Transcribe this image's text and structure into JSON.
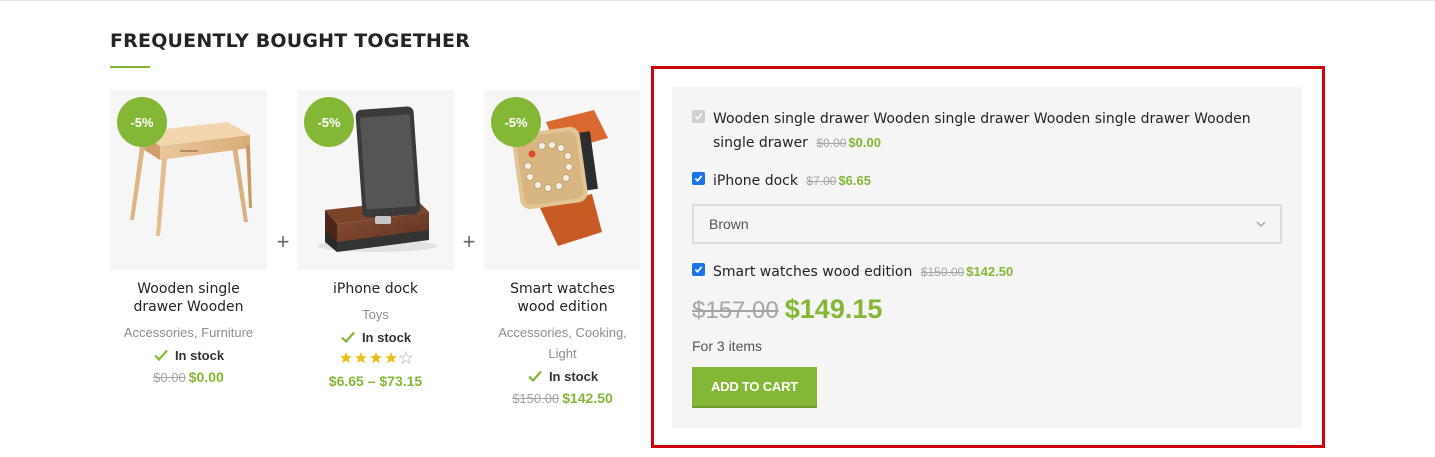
{
  "section": {
    "title": "FREQUENTLY BOUGHT TOGETHER"
  },
  "colors": {
    "accent": "#83b735",
    "highlight": "#d0010a",
    "checkbox": "#1a73e8"
  },
  "products": [
    {
      "badge": "-5%",
      "name": "Wooden single drawer Wooden",
      "categories": "Accessories, Furniture",
      "stock": "In stock",
      "old_price": "$0.00",
      "price": "$0.00",
      "image_icon": "wooden-table-image"
    },
    {
      "badge": "-5%",
      "name": "iPhone dock",
      "categories": "Toys",
      "stock": "In stock",
      "rating": 4,
      "rating_max": 5,
      "price_range": "$6.65 – $73.15",
      "image_icon": "iphone-dock-image"
    },
    {
      "badge": "-5%",
      "name": "Smart watches wood edition",
      "categories_line1": "Accessories, Cooking,",
      "categories_line2": "Light",
      "stock": "In stock",
      "old_price": "$150.00",
      "price": "$142.50",
      "image_icon": "wood-watch-image"
    }
  ],
  "plus_sign": "+",
  "bundle": {
    "options": [
      {
        "label_line1": "Wooden single drawer Wooden single drawer Wooden single drawer Wooden",
        "label_line2": "single drawer",
        "old_price": "$0.00",
        "price": "$0.00",
        "checked": true,
        "disabled": true
      },
      {
        "label": "iPhone dock",
        "old_price": "$7.00",
        "price": "$6.65",
        "checked": true
      },
      {
        "label": "Smart watches wood edition",
        "old_price": "$150.00",
        "price": "$142.50",
        "checked": true
      }
    ],
    "variation_select": {
      "value": "Brown"
    },
    "total_old": "$157.00",
    "total_new": "$149.15",
    "items_text": "For 3 items",
    "button_label": "ADD TO CART"
  }
}
